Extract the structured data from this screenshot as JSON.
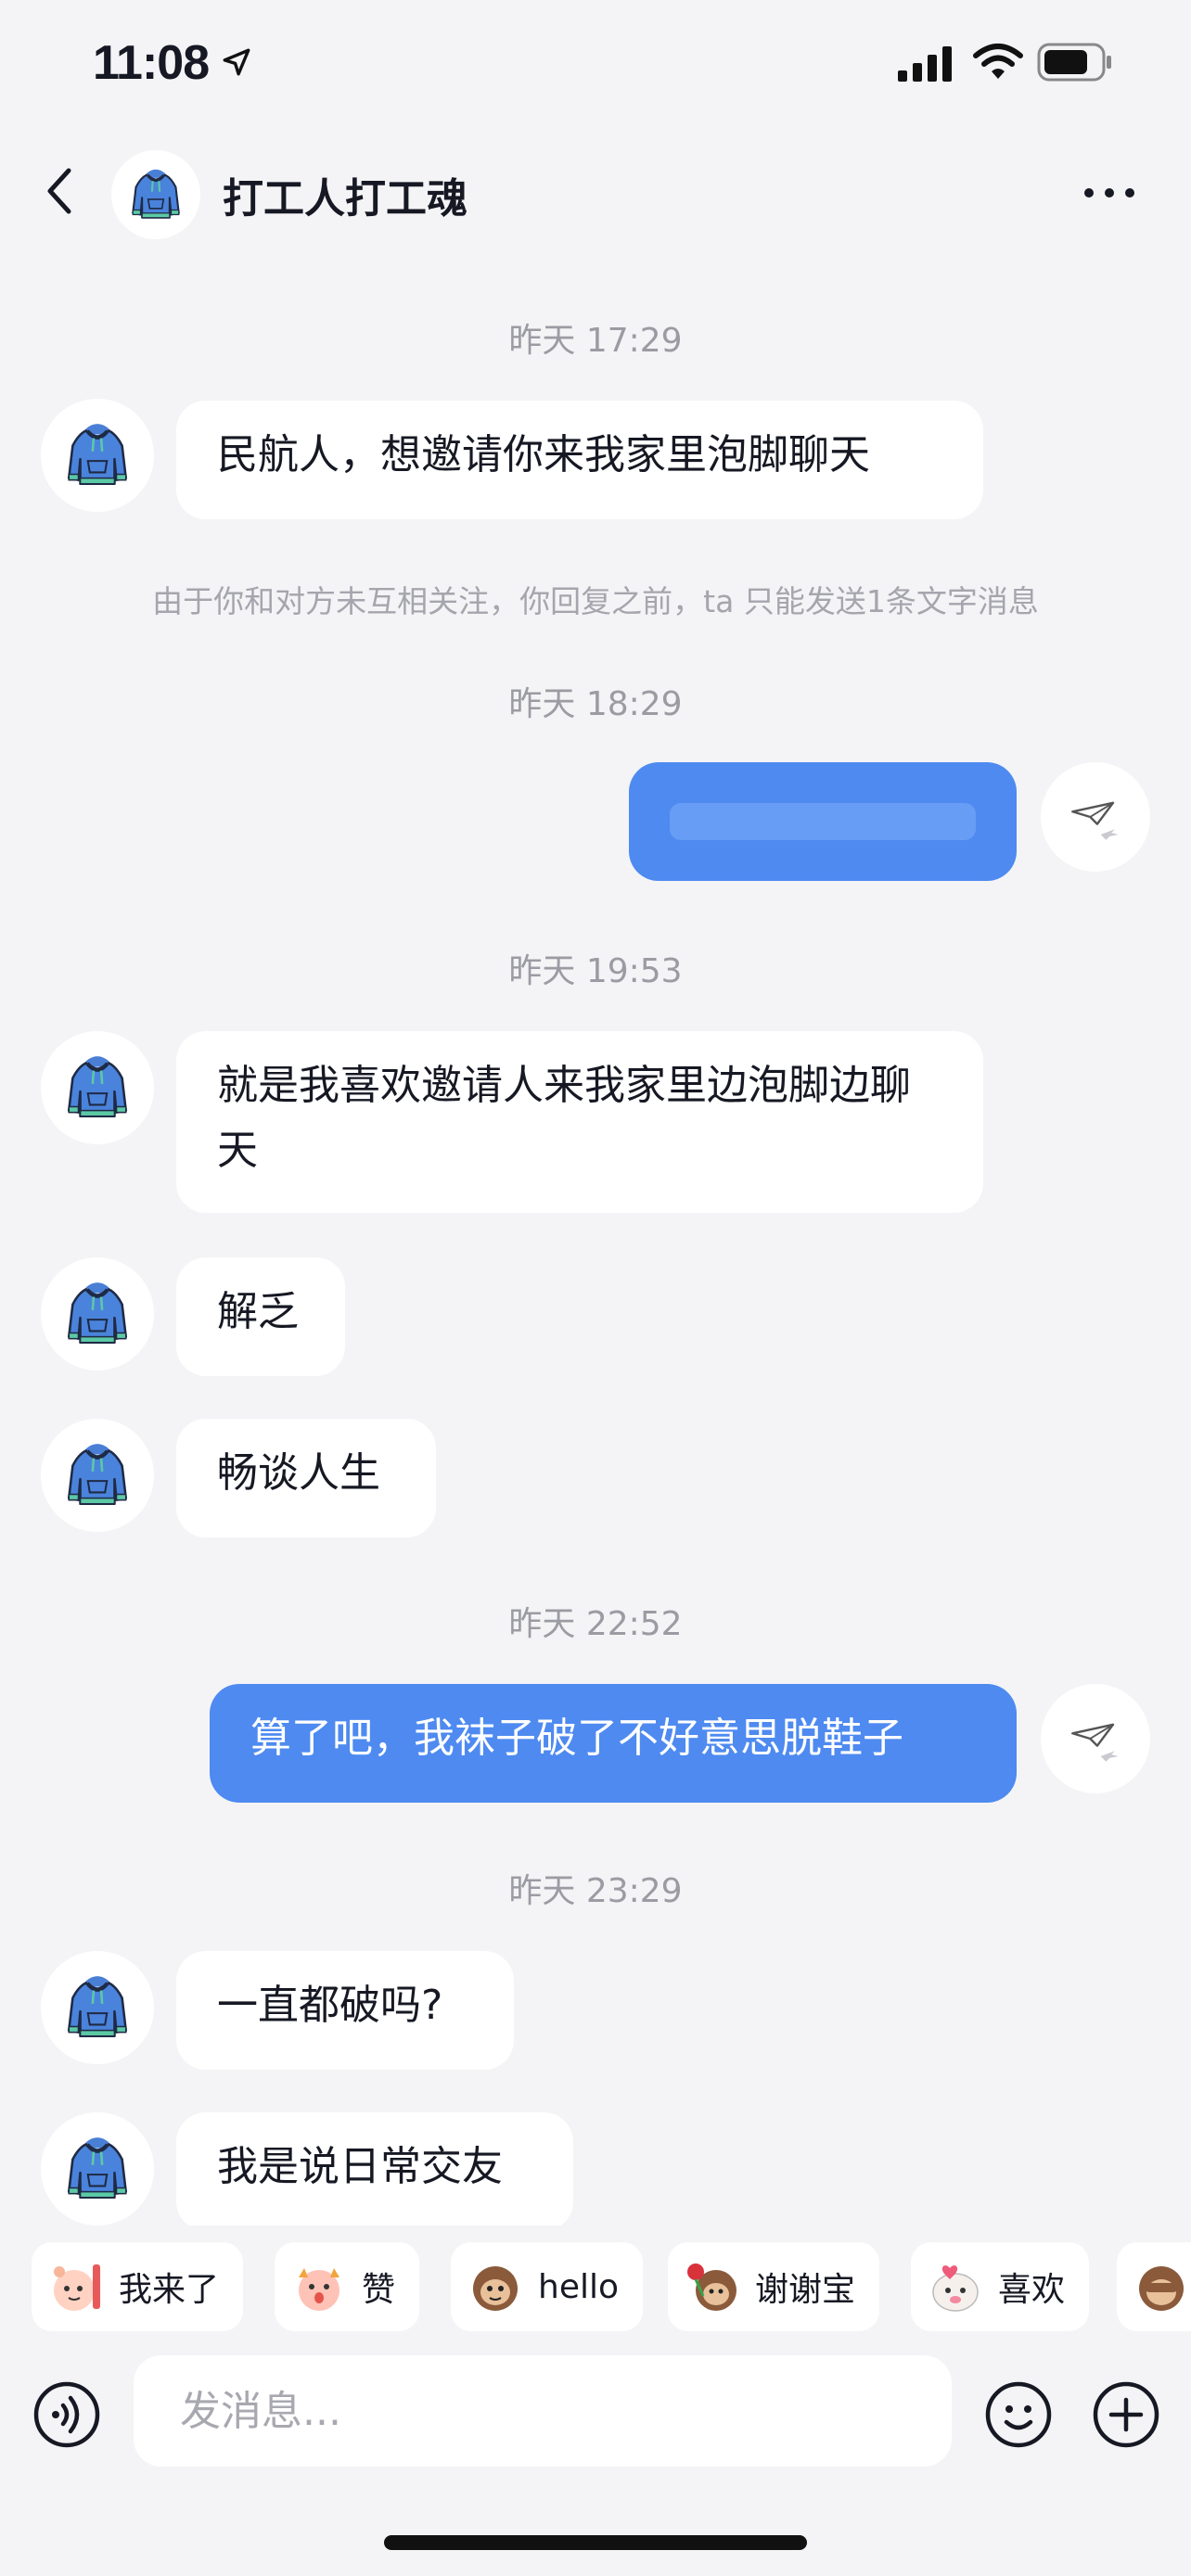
{
  "status_bar": {
    "time": "11:08"
  },
  "header": {
    "title": "打工人打工魂"
  },
  "messages": {
    "t1": "昨天 17:29",
    "m1": "民航人，想邀请你来我家里泡脚聊天",
    "notice": "由于你和对方未互相关注，你回复之前，ta 只能发送1条文字消息",
    "t2": "昨天 18:29",
    "t3": "昨天 19:53",
    "m3": "就是我喜欢邀请人来我家里边泡脚边聊天",
    "m4": "解乏",
    "m5": "畅谈人生",
    "t4": "昨天 22:52",
    "m6": "算了吧，我袜子破了不好意思脱鞋子",
    "t5": "昨天 23:29",
    "m7": "一直都破吗?",
    "m8": "我是说日常交友"
  },
  "quick_replies": [
    "我来了",
    "赞",
    "hello",
    "谢谢宝",
    "喜欢"
  ],
  "input": {
    "placeholder": "发消息..."
  },
  "colors": {
    "accent": "#4e8af0",
    "background": "#f4f4f6"
  },
  "icons": [
    "location-arrow-icon",
    "cellular-signal-icon",
    "wifi-icon",
    "battery-icon",
    "back-arrow-icon",
    "more-icon",
    "hoodie-avatar-icon",
    "paper-plane-icon",
    "voice-icon",
    "emoji-icon",
    "plus-icon"
  ]
}
